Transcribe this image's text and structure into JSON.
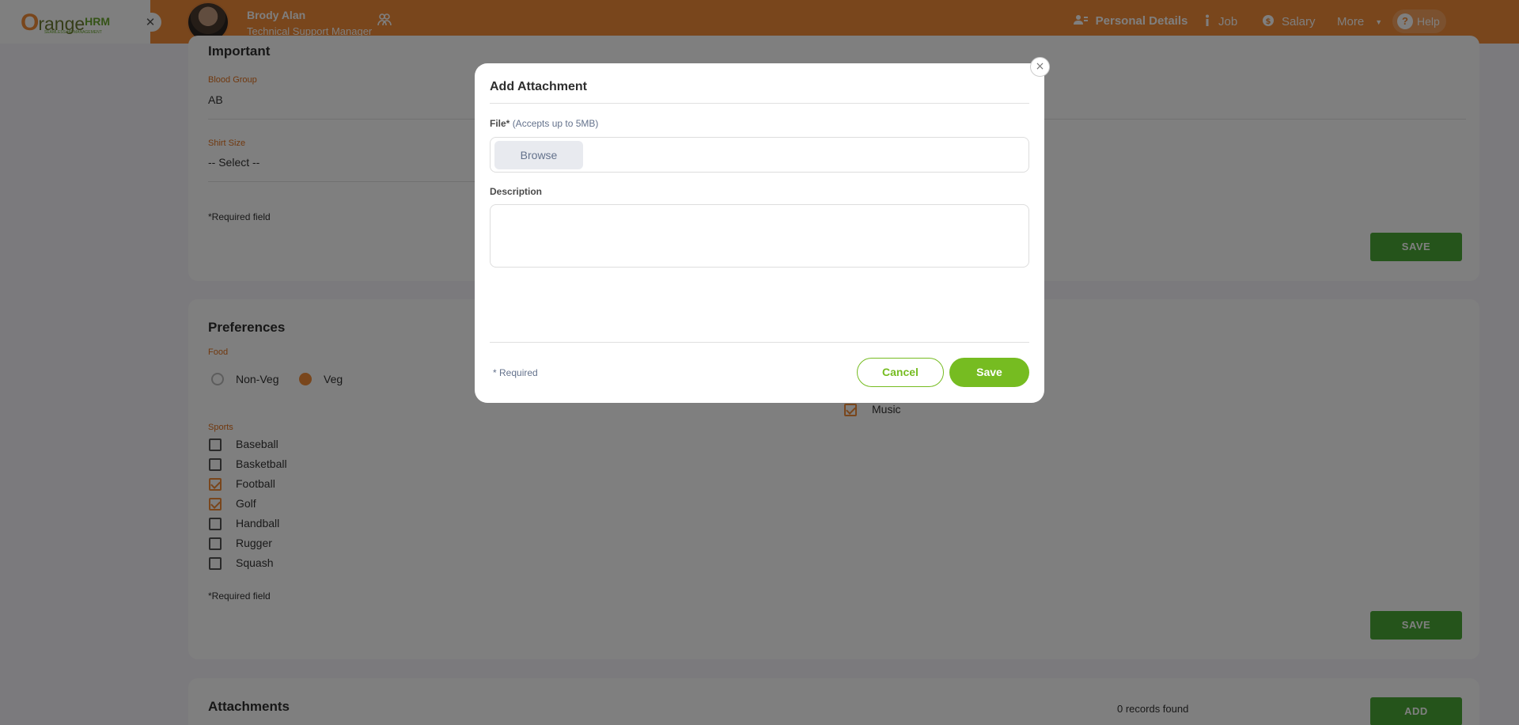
{
  "topbar": {
    "logo": {
      "o": "O",
      "rest": "range",
      "hrm": "HRM",
      "tagline": "SEAMLESS HR MANAGEMENT"
    },
    "brand_close": "✕",
    "user": {
      "name": "Brody Alan",
      "role": "Technical Support Manager"
    },
    "tabs": [
      {
        "label": "Personal Details",
        "icon": "person-card-icon",
        "active": true
      },
      {
        "label": "Job",
        "icon": "info-icon"
      },
      {
        "label": "Salary",
        "icon": "dollar-icon"
      },
      {
        "label": "More",
        "icon": "caret-down-icon"
      }
    ],
    "help_label": "Help"
  },
  "important": {
    "title": "Important",
    "blood_group_label": "Blood Group",
    "blood_group_value": "AB",
    "shirt_size_label": "Shirt Size",
    "shirt_size_value": "-- Select --",
    "required_note": "*Required field",
    "save_label": "SAVE"
  },
  "preferences": {
    "title": "Preferences",
    "food_label": "Food",
    "food_options": [
      {
        "label": "Non-Veg",
        "selected": false
      },
      {
        "label": "Veg",
        "selected": true
      }
    ],
    "sports_label": "Sports",
    "sports": [
      {
        "label": "Baseball",
        "checked": false
      },
      {
        "label": "Basketball",
        "checked": false
      },
      {
        "label": "Football",
        "checked": true
      },
      {
        "label": "Golf",
        "checked": true
      },
      {
        "label": "Handball",
        "checked": false
      },
      {
        "label": "Rugger",
        "checked": false
      },
      {
        "label": "Squash",
        "checked": false
      }
    ],
    "hobby_visible": {
      "label": "Music",
      "checked": true
    },
    "required_note": "*Required field",
    "save_label": "SAVE"
  },
  "attachments": {
    "title": "Attachments",
    "records": "0 records found",
    "add_label": "ADD"
  },
  "modal": {
    "close": "×",
    "title": "Add Attachment",
    "file_label": "File*",
    "file_hint": "(Accepts up to 5MB)",
    "browse_label": "Browse",
    "description_label": "Description",
    "description_value": "",
    "required_note": "* Required",
    "cancel_label": "Cancel",
    "save_label": "Save"
  },
  "colors": {
    "brand_orange": "#f28c38",
    "accent_green": "#76bc21",
    "save_green": "#4aa837"
  }
}
